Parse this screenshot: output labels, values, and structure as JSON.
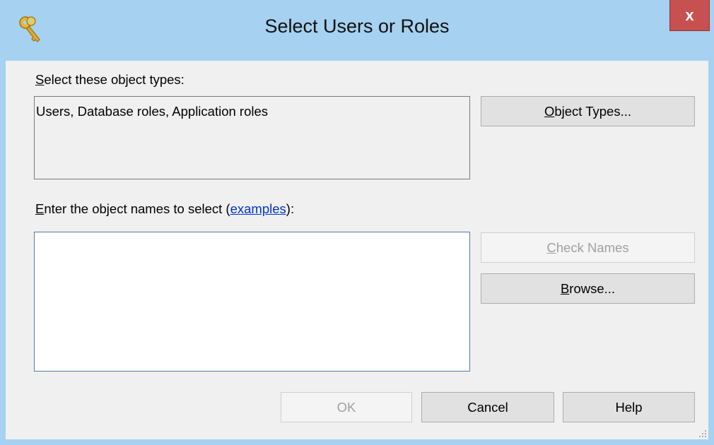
{
  "window": {
    "title": "Select Users or Roles",
    "close_glyph": "x",
    "icon": "keys-icon"
  },
  "object_types": {
    "label_accel": "S",
    "label_rest": "elect these object types:",
    "value": "Users, Database roles, Application roles",
    "button_accel": "O",
    "button_rest": "bject Types..."
  },
  "object_names": {
    "label_accel": "E",
    "label_rest": "nter the object names to select (",
    "link_text": "examples",
    "label_end": "):",
    "value": ""
  },
  "buttons": {
    "check_names_accel": "C",
    "check_names_rest": "heck Names",
    "browse_accel": "B",
    "browse_rest": "rowse...",
    "ok": "OK",
    "cancel": "Cancel",
    "help": "Help"
  },
  "colors": {
    "titlebar": "#a6d1f0",
    "close": "#c75050",
    "link": "#0033cc"
  }
}
